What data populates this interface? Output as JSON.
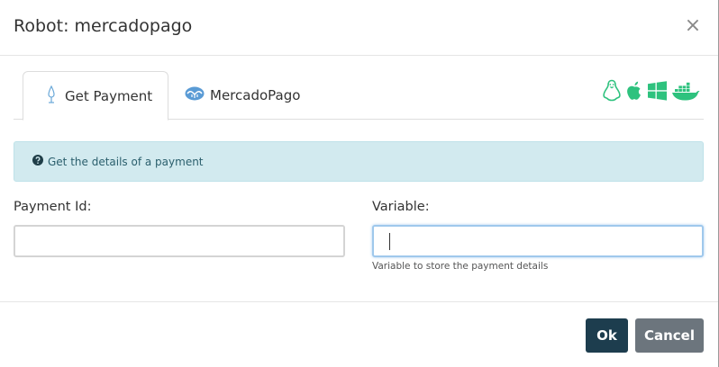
{
  "dialog": {
    "title": "Robot: mercadopago",
    "close_label": "×"
  },
  "tabs": [
    {
      "label": "Get Payment",
      "icon": "payment-drop-icon",
      "active": true
    },
    {
      "label": "MercadoPago",
      "icon": "mercadopago-logo-icon",
      "active": false
    }
  ],
  "platforms": [
    "linux-icon",
    "apple-icon",
    "windows-icon",
    "docker-icon"
  ],
  "info": {
    "icon": "question-circle-icon",
    "text": "Get the details of a payment"
  },
  "form": {
    "payment_id": {
      "label": "Payment Id:",
      "value": "",
      "placeholder": ""
    },
    "variable": {
      "label": "Variable:",
      "value": "",
      "placeholder": "",
      "help": "Variable to store the payment details"
    }
  },
  "footer": {
    "ok_label": "Ok",
    "cancel_label": "Cancel"
  },
  "colors": {
    "accent": "#1d3d4e",
    "cancel": "#6c757d",
    "info_bg": "#d2eaef",
    "platform_icon": "#2ec27e"
  }
}
